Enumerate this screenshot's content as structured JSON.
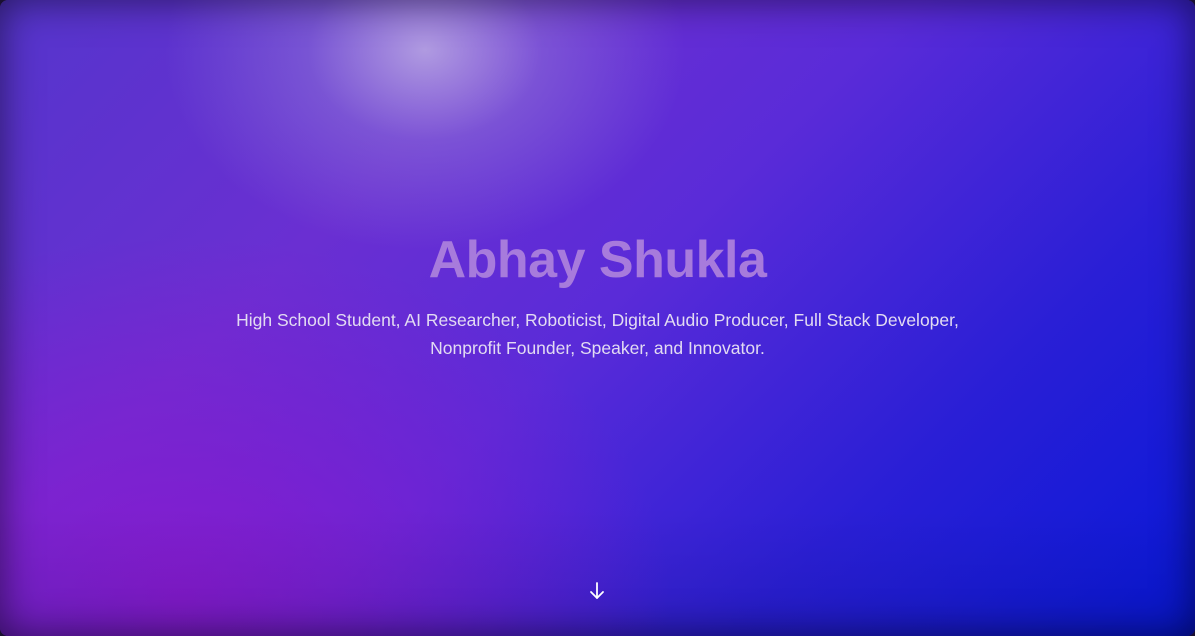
{
  "hero": {
    "name": "Abhay Shukla",
    "tagline": "High School Student, AI Researcher, Roboticist, Digital Audio Producer, Full Stack Developer, Nonprofit Founder, Speaker, and Innovator.",
    "scroll_icon": "arrow-down-icon"
  },
  "colors": {
    "title": "#a77bdc",
    "subtitle": "#e2dbf2",
    "gradient_purple": "#7a1ed0",
    "gradient_blue": "#0718d8"
  }
}
